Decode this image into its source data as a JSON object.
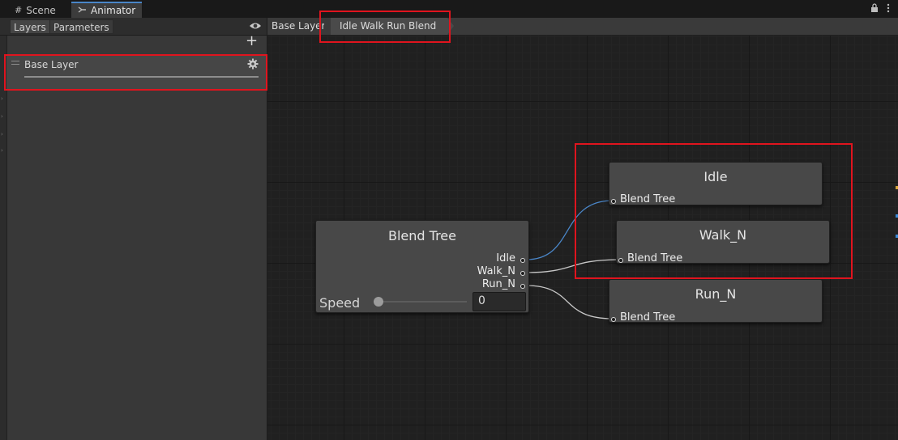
{
  "tabs": [
    {
      "label": "Scene",
      "icon": "grid-icon"
    },
    {
      "label": "Animator",
      "icon": "animator-icon"
    }
  ],
  "window_icons": [
    "lock-icon",
    "menu-icon"
  ],
  "left_panel": {
    "tabs": [
      "Layers",
      "Parameters"
    ],
    "visibility_icon": "eye-icon",
    "add_icon": "plus-icon",
    "layers": [
      {
        "name": "Base Layer",
        "icon": "gear-icon"
      }
    ]
  },
  "breadcrumb": [
    "Base Layer",
    "Idle Walk Run Blend"
  ],
  "blend_tree": {
    "title": "Blend Tree",
    "outputs": [
      "Idle",
      "Walk_N",
      "Run_N"
    ],
    "parameter": {
      "label": "Speed",
      "value": "0",
      "slider_fraction": 0
    }
  },
  "motion_nodes": [
    {
      "title": "Idle",
      "sub": "Blend Tree"
    },
    {
      "title": "Walk_N",
      "sub": "Blend Tree"
    },
    {
      "title": "Run_N",
      "sub": "Blend Tree"
    }
  ],
  "colors": {
    "highlight": "#e0141e",
    "active_link": "#4a86c8",
    "idle_link": "#c8c8c8"
  }
}
